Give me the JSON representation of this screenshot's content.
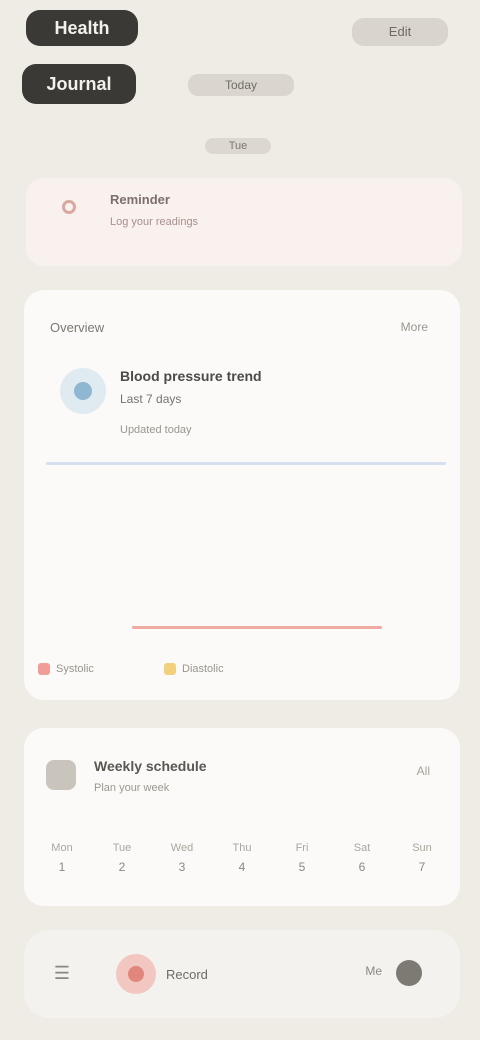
{
  "header": {
    "title_line1": "Health",
    "title_line2": "Journal",
    "action": "Edit",
    "subtitle": "Today",
    "caption": "Tue"
  },
  "alert": {
    "title": "Reminder",
    "subtitle": "Log your readings"
  },
  "main_card": {
    "label": "Overview",
    "action": "More",
    "row_title": "Blood pressure trend",
    "row_subtitle": "Last 7 days",
    "row_meta": "Updated today",
    "legend": [
      {
        "label": "Systolic",
        "color": "#ef9d96"
      },
      {
        "label": "Diastolic",
        "color": "#f2d07d"
      }
    ],
    "line_color": "#f0a9a3",
    "divider_color": "#d6dff0"
  },
  "schedule": {
    "title": "Weekly schedule",
    "subtitle": "Plan your week",
    "action": "All",
    "days": [
      {
        "name": "Mon",
        "num": "1"
      },
      {
        "name": "Tue",
        "num": "2"
      },
      {
        "name": "Wed",
        "num": "3"
      },
      {
        "name": "Thu",
        "num": "4"
      },
      {
        "name": "Fri",
        "num": "5"
      },
      {
        "name": "Sat",
        "num": "6"
      },
      {
        "name": "Sun",
        "num": "7"
      }
    ]
  },
  "bottombar": {
    "left_icon": "menu-icon",
    "record_label": "Record",
    "right_label": "Me",
    "avatar": "avatar"
  }
}
